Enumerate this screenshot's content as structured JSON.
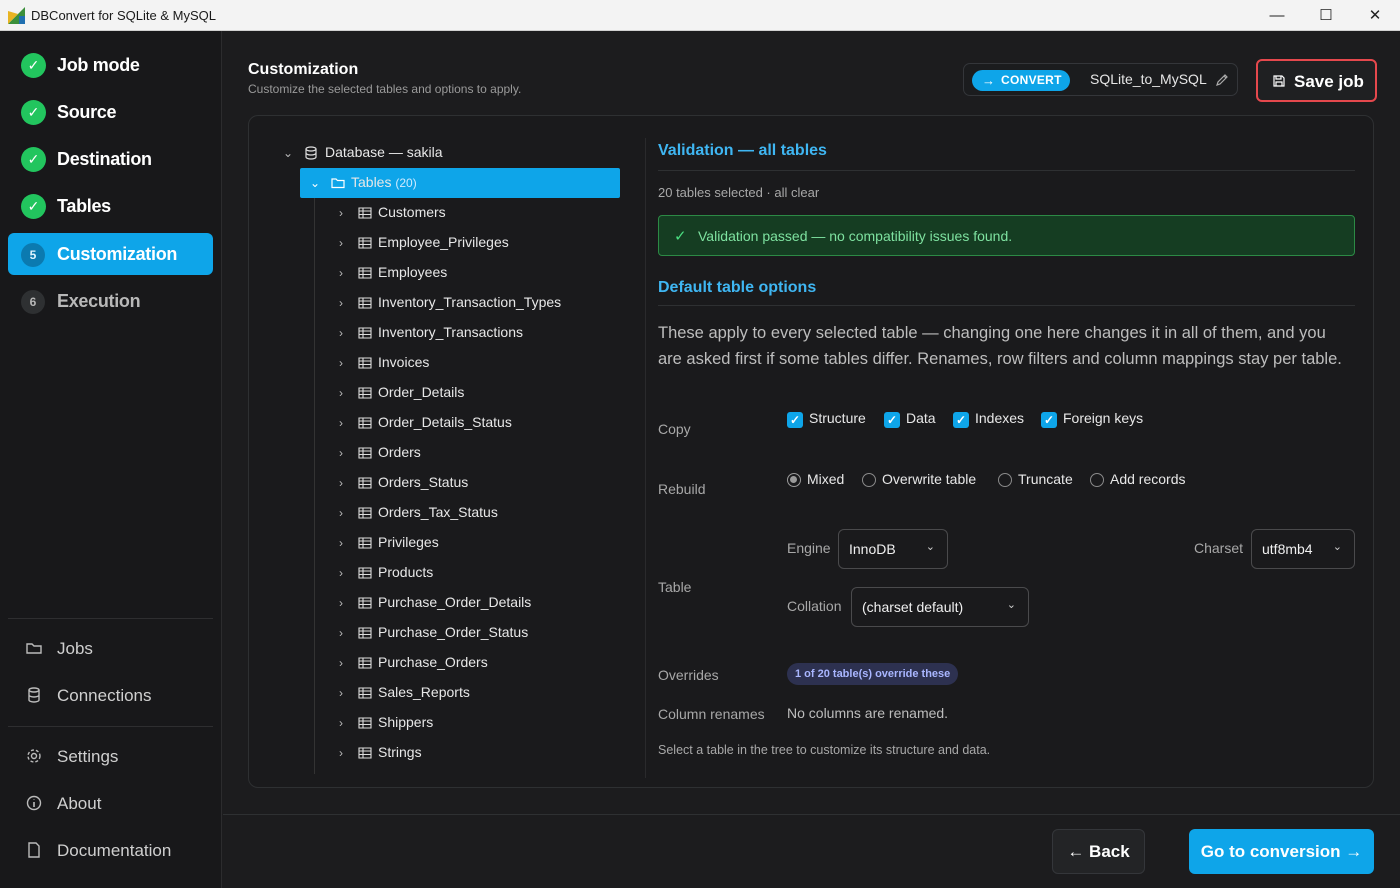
{
  "window": {
    "title": "DBConvert for SQLite & MySQL",
    "minimize_icon": "minimize-icon",
    "maximize_icon": "maximize-icon",
    "close_icon": "close-icon"
  },
  "sidebar": {
    "steps": [
      {
        "label": "Job mode",
        "status": "done",
        "num": "1"
      },
      {
        "label": "Source",
        "status": "done",
        "num": "2"
      },
      {
        "label": "Destination",
        "status": "done",
        "num": "3"
      },
      {
        "label": "Tables",
        "status": "done",
        "num": "4"
      },
      {
        "label": "Customization",
        "status": "active",
        "num": "5"
      },
      {
        "label": "Execution",
        "status": "pending",
        "num": "6"
      }
    ],
    "nav": [
      {
        "label": "Jobs",
        "icon": "folder-icon"
      },
      {
        "label": "Connections",
        "icon": "database-icon"
      },
      {
        "label": "Settings",
        "icon": "gear-icon"
      },
      {
        "label": "About",
        "icon": "info-icon"
      },
      {
        "label": "Documentation",
        "icon": "document-icon"
      }
    ]
  },
  "header": {
    "title": "Customization",
    "subtitle": "Customize the selected tables and options to apply.",
    "mode_badge": "CONVERT",
    "job_name": "SQLite_to_MySQL",
    "save_label": "Save job"
  },
  "tree": {
    "database": "Database — sakila",
    "tables_label": "Tables",
    "tables_count": "(20)",
    "tables": [
      "Customers",
      "Employee_Privileges",
      "Employees",
      "Inventory_Transaction_Types",
      "Inventory_Transactions",
      "Invoices",
      "Order_Details",
      "Order_Details_Status",
      "Orders",
      "Orders_Status",
      "Orders_Tax_Status",
      "Privileges",
      "Products",
      "Purchase_Order_Details",
      "Purchase_Order_Status",
      "Purchase_Orders",
      "Sales_Reports",
      "Shippers",
      "Strings"
    ]
  },
  "validation": {
    "title": "Validation — all tables",
    "summary": "20 tables selected · all clear",
    "message": "Validation passed — no compatibility issues found."
  },
  "defaults": {
    "title": "Default table options",
    "description": "These apply to every selected table — changing one here changes it in all of them, and you are asked first if some tables differ. Renames, row filters and column mappings stay per table.",
    "copy_label": "Copy",
    "copy_options": [
      {
        "label": "Structure",
        "checked": true
      },
      {
        "label": "Data",
        "checked": true
      },
      {
        "label": "Indexes",
        "checked": true
      },
      {
        "label": "Foreign keys",
        "checked": true
      }
    ],
    "rebuild_label": "Rebuild",
    "rebuild_options": [
      {
        "label": "Mixed",
        "selected": true
      },
      {
        "label": "Overwrite table",
        "selected": false
      },
      {
        "label": "Truncate",
        "selected": false
      },
      {
        "label": "Add records",
        "selected": false
      }
    ],
    "table_label": "Table",
    "engine_label": "Engine",
    "engine_value": "InnoDB",
    "charset_label": "Charset",
    "charset_value": "utf8mb4",
    "collation_label": "Collation",
    "collation_value": "(charset default)",
    "overrides_label": "Overrides",
    "overrides_badge": "1 of 20 table(s) override these",
    "renames_label": "Column renames",
    "renames_value": "No columns are renamed.",
    "hint": "Select a table in the tree to customize its structure and data."
  },
  "footer": {
    "back_label": "← Back",
    "go_label": "Go to conversion →"
  },
  "colors": {
    "accent": "#0ea5e9",
    "success": "#22c55e",
    "danger": "#e5484d"
  }
}
